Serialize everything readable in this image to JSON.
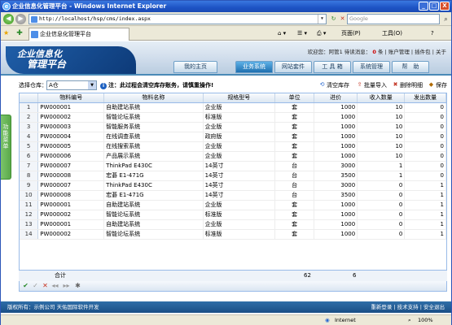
{
  "window": {
    "title": "企业信息化管理平台 - Windows Internet Explorer",
    "min": "_",
    "max": "□",
    "close": "X"
  },
  "browser": {
    "url": "http://localhost/hsp/cms/index.aspx",
    "search_placeholder": "Google",
    "tab_title": "企业信息化管理平台",
    "cmd_page": "页面(P)",
    "cmd_tools": "工具(O)",
    "cmd_help": "?"
  },
  "header": {
    "logo_line1": "企业信息化",
    "logo_line2": "管理平台",
    "info_text": "欢迎您：阿管1  待读消息：",
    "msg_count": "0",
    "msg_unit": "条",
    "links": [
      "账户管理",
      "插件包",
      "关于"
    ],
    "nav": [
      "我的主页",
      "业务系统",
      "网站套件",
      "工 具 箱",
      "系统管理",
      "帮　助"
    ]
  },
  "sidebar": {
    "label": "功能菜单"
  },
  "toolbar": {
    "warehouse_label": "选择仓库：",
    "warehouse_value": "A仓",
    "warning": "注：此过程会清空库存账务，请慎重操作!",
    "actions": [
      "清空库存",
      "批量导入",
      "删除明细",
      "保存"
    ]
  },
  "grid": {
    "columns": [
      "",
      "物料编号",
      "物料名称",
      "规格型号",
      "单位",
      "进价",
      "收入数量",
      "发出数量"
    ],
    "rows": [
      [
        "1",
        "PW000001",
        "自助建站系统",
        "企业版",
        "套",
        "1000",
        "10",
        "0"
      ],
      [
        "2",
        "PW000002",
        "智能论坛系统",
        "标准版",
        "套",
        "1000",
        "10",
        "0"
      ],
      [
        "3",
        "PW000003",
        "智能服务系统",
        "企业版",
        "套",
        "1000",
        "10",
        "0"
      ],
      [
        "4",
        "PW000004",
        "在线调查系统",
        "政府版",
        "套",
        "1000",
        "10",
        "0"
      ],
      [
        "5",
        "PW000005",
        "在线搜索系统",
        "企业版",
        "套",
        "1000",
        "10",
        "0"
      ],
      [
        "6",
        "PW000006",
        "产品展示系统",
        "企业版",
        "套",
        "1000",
        "10",
        "0"
      ],
      [
        "7",
        "PW000007",
        "ThinkPad E430C",
        "14英寸",
        "台",
        "3000",
        "1",
        "0"
      ],
      [
        "8",
        "PW000008",
        "宏碁 E1-471G",
        "14英寸",
        "台",
        "3500",
        "1",
        "0"
      ],
      [
        "9",
        "PW000007",
        "ThinkPad E430C",
        "14英寸",
        "台",
        "3000",
        "0",
        "1"
      ],
      [
        "10",
        "PW000008",
        "宏碁 E1-471G",
        "14英寸",
        "台",
        "3500",
        "0",
        "1"
      ],
      [
        "11",
        "PW000001",
        "自助建站系统",
        "企业版",
        "套",
        "1000",
        "0",
        "1"
      ],
      [
        "12",
        "PW000002",
        "智能论坛系统",
        "标准版",
        "套",
        "1000",
        "0",
        "1"
      ],
      [
        "13",
        "PW000001",
        "自助建站系统",
        "企业版",
        "套",
        "1000",
        "0",
        "1"
      ],
      [
        "14",
        "PW000002",
        "智能论坛系统",
        "标准版",
        "套",
        "1000",
        "0",
        "1"
      ]
    ],
    "summary": {
      "label": "合计",
      "in_total": "62",
      "out_total": "6"
    }
  },
  "footer": {
    "copyright": "版权所有：示例公司  天佑国际软件开发",
    "links": [
      "重新登录",
      "技术支持",
      "安全退出"
    ]
  },
  "status": {
    "zone": "Internet",
    "zoom": "100%"
  }
}
